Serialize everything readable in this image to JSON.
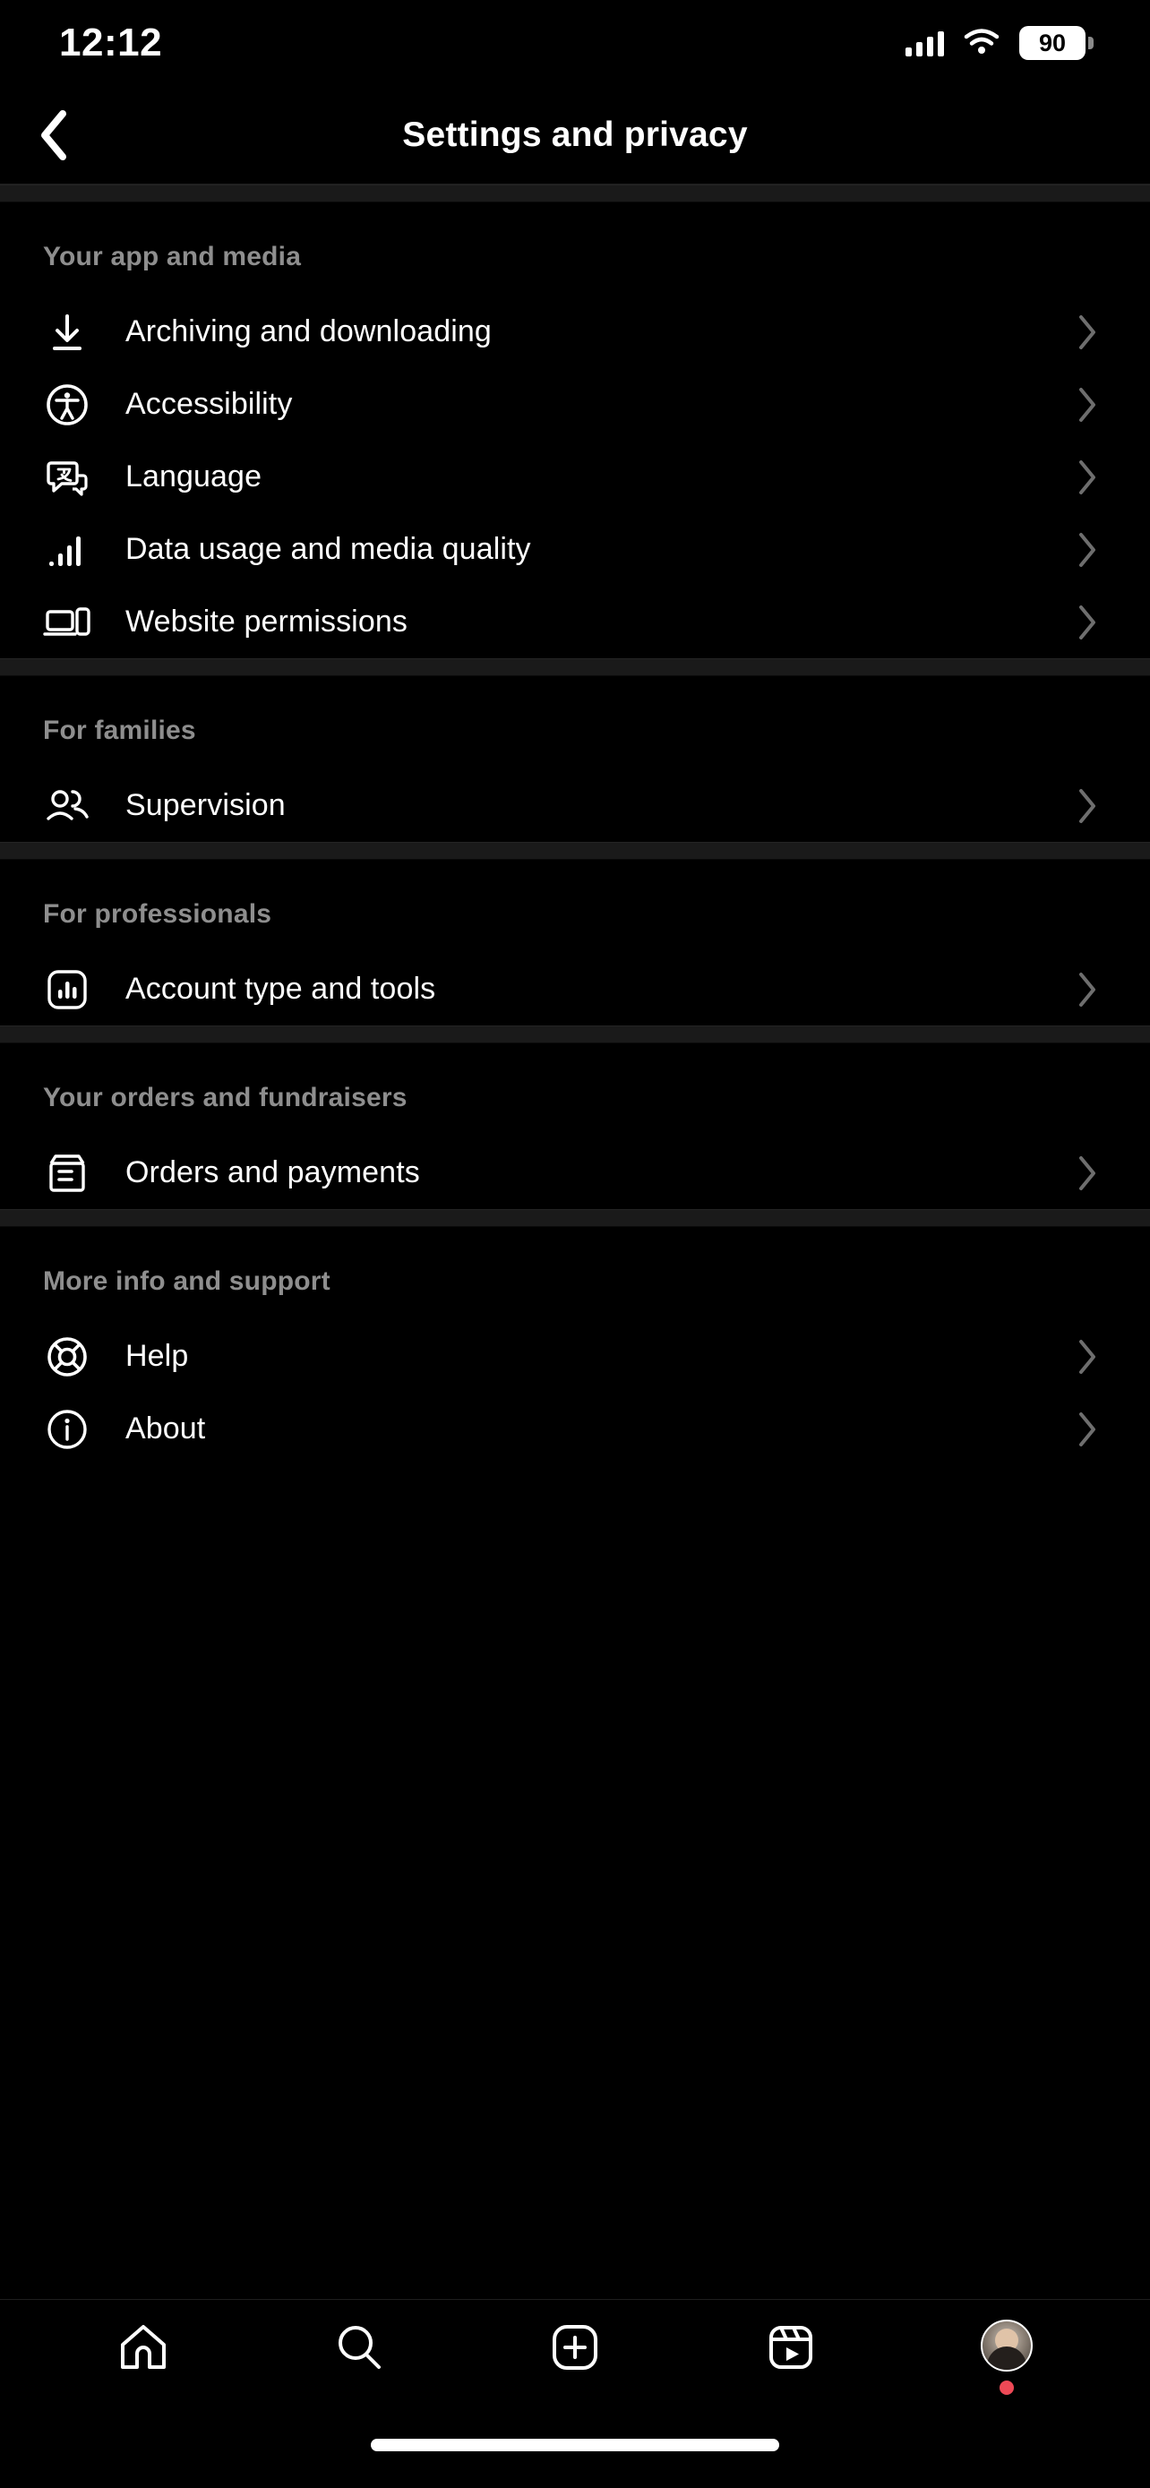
{
  "status_bar": {
    "time": "12:12",
    "signal_icon": "cellular-signal-icon",
    "wifi_icon": "wifi-icon",
    "battery_level": "90"
  },
  "header": {
    "back_icon": "back-chevron-icon",
    "title": "Settings and privacy"
  },
  "sections": [
    {
      "title": "Your app and media",
      "items": [
        {
          "label": "Archiving and downloading",
          "icon": "download-icon"
        },
        {
          "label": "Accessibility",
          "icon": "accessibility-icon"
        },
        {
          "label": "Language",
          "icon": "language-icon"
        },
        {
          "label": "Data usage and media quality",
          "icon": "bar-chart-icon"
        },
        {
          "label": "Website permissions",
          "icon": "devices-icon"
        }
      ]
    },
    {
      "title": "For families",
      "items": [
        {
          "label": "Supervision",
          "icon": "people-icon"
        }
      ]
    },
    {
      "title": "For professionals",
      "items": [
        {
          "label": "Account type and tools",
          "icon": "insights-icon"
        }
      ]
    },
    {
      "title": "Your orders and fundraisers",
      "items": [
        {
          "label": "Orders and payments",
          "icon": "box-icon"
        }
      ]
    },
    {
      "title": "More info and support",
      "items": [
        {
          "label": "Help",
          "icon": "life-ring-icon"
        },
        {
          "label": "About",
          "icon": "info-circle-icon"
        }
      ]
    }
  ],
  "tab_bar": {
    "tabs": [
      {
        "name": "home",
        "icon": "home-icon"
      },
      {
        "name": "search",
        "icon": "search-icon"
      },
      {
        "name": "create",
        "icon": "plus-square-icon"
      },
      {
        "name": "reels",
        "icon": "reels-icon"
      },
      {
        "name": "profile",
        "icon": "profile-avatar",
        "has_badge": true
      }
    ]
  },
  "colors": {
    "background": "#000000",
    "section_header": "#8e8e8e",
    "divider": "#1a1a1a",
    "chevron": "#6e6e6e",
    "badge": "#ed4956"
  }
}
